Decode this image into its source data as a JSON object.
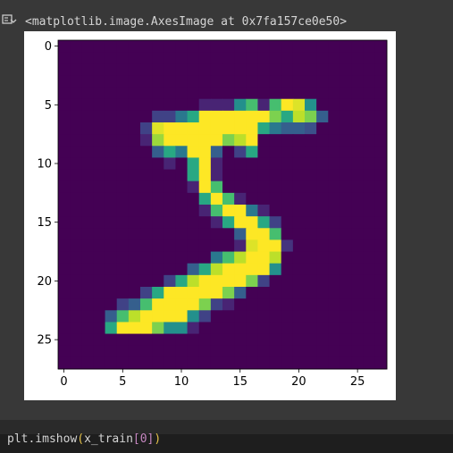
{
  "output": {
    "text": "<matplotlib.image.AxesImage at 0x7fa157ce0e50>",
    "icon": "output-toggle-icon"
  },
  "code": {
    "prefix": "plt.imshow",
    "open": "(",
    "arg": "x_train",
    "index": "[0]",
    "close": ")"
  },
  "colors": {
    "page": "#383838",
    "figure": "#ffffff",
    "viridis": [
      "#440154",
      "#482878",
      "#3e4989",
      "#31688e",
      "#26828e",
      "#1f9e89",
      "#35b779",
      "#6ece58",
      "#b5de2b",
      "#fde725"
    ]
  },
  "chart_data": {
    "type": "heatmap",
    "colormap": "viridis",
    "title": "",
    "xlabel": "",
    "ylabel": "",
    "xlim": [
      -0.5,
      27.5
    ],
    "ylim": [
      27.5,
      -0.5
    ],
    "xticks": [
      0,
      5,
      10,
      15,
      20,
      25
    ],
    "yticks": [
      0,
      5,
      10,
      15,
      20,
      25
    ],
    "shape": [
      28,
      28
    ],
    "values": [
      [
        0,
        0,
        0,
        0,
        0,
        0,
        0,
        0,
        0,
        0,
        0,
        0,
        0,
        0,
        0,
        0,
        0,
        0,
        0,
        0,
        0,
        0,
        0,
        0,
        0,
        0,
        0,
        0
      ],
      [
        0,
        0,
        0,
        0,
        0,
        0,
        0,
        0,
        0,
        0,
        0,
        0,
        0,
        0,
        0,
        0,
        0,
        0,
        0,
        0,
        0,
        0,
        0,
        0,
        0,
        0,
        0,
        0
      ],
      [
        0,
        0,
        0,
        0,
        0,
        0,
        0,
        0,
        0,
        0,
        0,
        0,
        0,
        0,
        0,
        0,
        0,
        0,
        0,
        0,
        0,
        0,
        0,
        0,
        0,
        0,
        0,
        0
      ],
      [
        0,
        0,
        0,
        0,
        0,
        0,
        0,
        0,
        0,
        0,
        0,
        0,
        0,
        0,
        0,
        0,
        0,
        0,
        0,
        0,
        0,
        0,
        0,
        0,
        0,
        0,
        0,
        0
      ],
      [
        0,
        0,
        0,
        0,
        0,
        0,
        0,
        0,
        0,
        0,
        0,
        0,
        0,
        0,
        0,
        0,
        0,
        0,
        0,
        0,
        0,
        0,
        0,
        0,
        0,
        0,
        0,
        0
      ],
      [
        0,
        0,
        0,
        0,
        0,
        0,
        0,
        0,
        0,
        0,
        0,
        0,
        0.1,
        0.1,
        0.1,
        0.5,
        0.7,
        0.1,
        0.7,
        1,
        0.95,
        0.5,
        0,
        0,
        0,
        0,
        0,
        0
      ],
      [
        0,
        0,
        0,
        0,
        0,
        0,
        0,
        0,
        0.2,
        0.2,
        0.4,
        0.6,
        1,
        1,
        1,
        1,
        1,
        1,
        0.8,
        0.6,
        0.9,
        0.8,
        0.3,
        0,
        0,
        0,
        0,
        0
      ],
      [
        0,
        0,
        0,
        0,
        0,
        0,
        0,
        0.2,
        0.95,
        1,
        1,
        1,
        1,
        1,
        1,
        1,
        1,
        0.6,
        0.4,
        0.3,
        0.3,
        0.25,
        0,
        0,
        0,
        0,
        0,
        0
      ],
      [
        0,
        0,
        0,
        0,
        0,
        0,
        0,
        0.1,
        0.85,
        1,
        1,
        1,
        1,
        1,
        0.8,
        0.9,
        1,
        0,
        0,
        0,
        0,
        0,
        0,
        0,
        0,
        0,
        0,
        0
      ],
      [
        0,
        0,
        0,
        0,
        0,
        0,
        0,
        0,
        0.3,
        0.6,
        0.4,
        1,
        1,
        0.3,
        0,
        0.2,
        0.6,
        0,
        0,
        0,
        0,
        0,
        0,
        0,
        0,
        0,
        0,
        0
      ],
      [
        0,
        0,
        0,
        0,
        0,
        0,
        0,
        0,
        0,
        0.1,
        0,
        0.6,
        1,
        0.1,
        0,
        0,
        0,
        0,
        0,
        0,
        0,
        0,
        0,
        0,
        0,
        0,
        0,
        0
      ],
      [
        0,
        0,
        0,
        0,
        0,
        0,
        0,
        0,
        0,
        0,
        0,
        0.6,
        1,
        0.1,
        0,
        0,
        0,
        0,
        0,
        0,
        0,
        0,
        0,
        0,
        0,
        0,
        0,
        0
      ],
      [
        0,
        0,
        0,
        0,
        0,
        0,
        0,
        0,
        0,
        0,
        0,
        0.1,
        1,
        0.7,
        0,
        0,
        0,
        0,
        0,
        0,
        0,
        0,
        0,
        0,
        0,
        0,
        0,
        0
      ],
      [
        0,
        0,
        0,
        0,
        0,
        0,
        0,
        0,
        0,
        0,
        0,
        0,
        0.6,
        1,
        0.7,
        0.1,
        0,
        0,
        0,
        0,
        0,
        0,
        0,
        0,
        0,
        0,
        0,
        0
      ],
      [
        0,
        0,
        0,
        0,
        0,
        0,
        0,
        0,
        0,
        0,
        0,
        0,
        0.1,
        0.7,
        1,
        1,
        0.4,
        0.1,
        0,
        0,
        0,
        0,
        0,
        0,
        0,
        0,
        0,
        0
      ],
      [
        0,
        0,
        0,
        0,
        0,
        0,
        0,
        0,
        0,
        0,
        0,
        0,
        0,
        0.1,
        0.6,
        1,
        1,
        0.6,
        0.2,
        0,
        0,
        0,
        0,
        0,
        0,
        0,
        0,
        0
      ],
      [
        0,
        0,
        0,
        0,
        0,
        0,
        0,
        0,
        0,
        0,
        0,
        0,
        0,
        0,
        0,
        0.3,
        1,
        1,
        0.7,
        0,
        0,
        0,
        0,
        0,
        0,
        0,
        0,
        0
      ],
      [
        0,
        0,
        0,
        0,
        0,
        0,
        0,
        0,
        0,
        0,
        0,
        0,
        0,
        0,
        0,
        0.1,
        0.95,
        1,
        1,
        0.15,
        0,
        0,
        0,
        0,
        0,
        0,
        0,
        0
      ],
      [
        0,
        0,
        0,
        0,
        0,
        0,
        0,
        0,
        0,
        0,
        0,
        0,
        0,
        0.4,
        0.7,
        0.9,
        1,
        1,
        0.9,
        0,
        0,
        0,
        0,
        0,
        0,
        0,
        0,
        0
      ],
      [
        0,
        0,
        0,
        0,
        0,
        0,
        0,
        0,
        0,
        0,
        0,
        0.3,
        0.6,
        0.9,
        1,
        1,
        1,
        1,
        0.5,
        0,
        0,
        0,
        0,
        0,
        0,
        0,
        0,
        0
      ],
      [
        0,
        0,
        0,
        0,
        0,
        0,
        0,
        0,
        0,
        0.2,
        0.6,
        0.9,
        1,
        1,
        1,
        1,
        0.8,
        0.2,
        0,
        0,
        0,
        0,
        0,
        0,
        0,
        0,
        0,
        0
      ],
      [
        0,
        0,
        0,
        0,
        0,
        0,
        0,
        0.2,
        0.6,
        1,
        1,
        1,
        1,
        1,
        0.8,
        0.3,
        0,
        0,
        0,
        0,
        0,
        0,
        0,
        0,
        0,
        0,
        0,
        0
      ],
      [
        0,
        0,
        0,
        0,
        0,
        0.2,
        0.3,
        0.7,
        1,
        1,
        1,
        1,
        0.8,
        0.2,
        0.1,
        0,
        0,
        0,
        0,
        0,
        0,
        0,
        0,
        0,
        0,
        0,
        0,
        0
      ],
      [
        0,
        0,
        0,
        0,
        0.3,
        0.7,
        0.9,
        1,
        1,
        1,
        1,
        0.5,
        0.2,
        0,
        0,
        0,
        0,
        0,
        0,
        0,
        0,
        0,
        0,
        0,
        0,
        0,
        0,
        0
      ],
      [
        0,
        0,
        0,
        0,
        0.6,
        1,
        1,
        1,
        0.8,
        0.5,
        0.5,
        0.1,
        0,
        0,
        0,
        0,
        0,
        0,
        0,
        0,
        0,
        0,
        0,
        0,
        0,
        0,
        0,
        0
      ],
      [
        0,
        0,
        0,
        0,
        0,
        0,
        0,
        0,
        0,
        0,
        0,
        0,
        0,
        0,
        0,
        0,
        0,
        0,
        0,
        0,
        0,
        0,
        0,
        0,
        0,
        0,
        0,
        0
      ],
      [
        0,
        0,
        0,
        0,
        0,
        0,
        0,
        0,
        0,
        0,
        0,
        0,
        0,
        0,
        0,
        0,
        0,
        0,
        0,
        0,
        0,
        0,
        0,
        0,
        0,
        0,
        0,
        0
      ],
      [
        0,
        0,
        0,
        0,
        0,
        0,
        0,
        0,
        0,
        0,
        0,
        0,
        0,
        0,
        0,
        0,
        0,
        0,
        0,
        0,
        0,
        0,
        0,
        0,
        0,
        0,
        0,
        0
      ]
    ]
  }
}
